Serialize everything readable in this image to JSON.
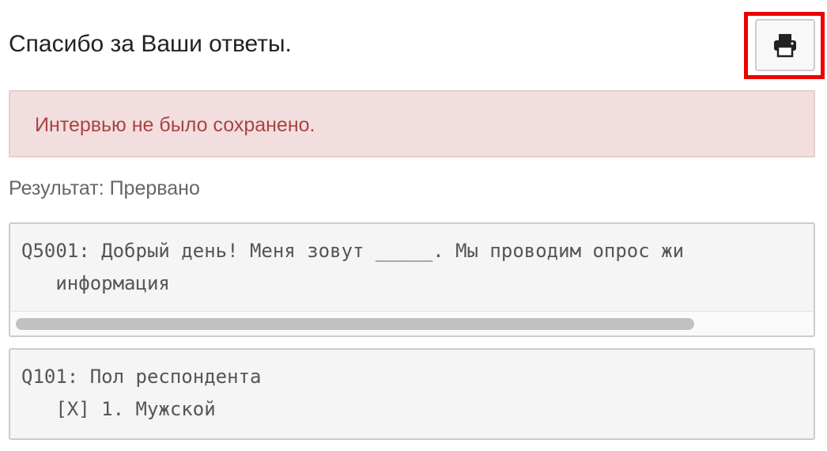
{
  "page": {
    "title": "Спасибо за Ваши ответы."
  },
  "toolbar": {
    "print_icon": "printer-icon"
  },
  "alert": {
    "message": "Интервью не было сохранено.",
    "color": "#a94442",
    "background": "#f2dede"
  },
  "result": {
    "text": "Результат: Прервано"
  },
  "questions": [
    {
      "line1": "Q5001: Добрый день! Меня зовут _____. Мы проводим опрос жи",
      "line2": "   информация"
    },
    {
      "line1": "Q101: Пол респондента",
      "line2": "   [X] 1. Мужской"
    }
  ],
  "colors": {
    "highlight": "#ee0000"
  }
}
